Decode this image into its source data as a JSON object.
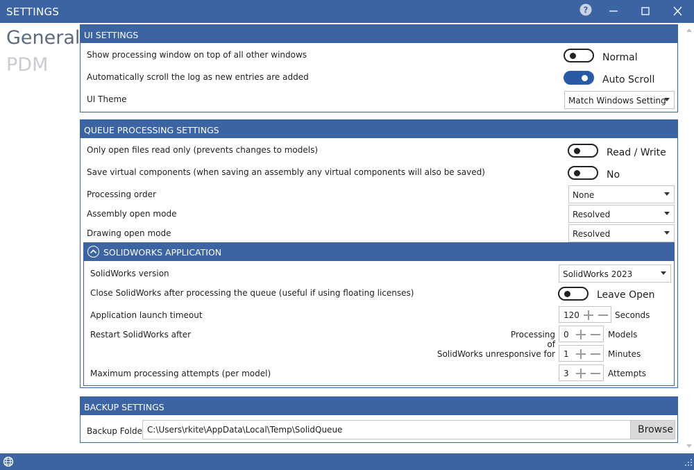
{
  "window": {
    "title": "SETTINGS",
    "help_icon": "question-circle-icon",
    "minimize_icon": "minimize-icon",
    "maximize_icon": "maximize-icon",
    "close_icon": "close-icon",
    "accent": "#3c63a2"
  },
  "nav": {
    "items": [
      {
        "label": "General",
        "active": true
      },
      {
        "label": "PDM",
        "active": false
      }
    ]
  },
  "ui_settings": {
    "header": "UI SETTINGS",
    "ontop": {
      "label": "Show processing window on top of all other windows",
      "state": "Normal",
      "on": false
    },
    "autoscroll": {
      "label": "Automatically scroll the log as new entries are added",
      "state": "Auto Scroll",
      "on": true
    },
    "theme": {
      "label": "UI Theme",
      "value": "Match Windows Setting"
    }
  },
  "queue_settings": {
    "header": "QUEUE PROCESSING SETTINGS",
    "readonly": {
      "label": "Only open files read only (prevents changes to models)",
      "state": "Read / Write",
      "on": false
    },
    "virtual": {
      "label": "Save virtual components (when saving an assembly any virtual components will also be saved)",
      "state": "No",
      "on": false
    },
    "order": {
      "label": "Processing order",
      "value": "None"
    },
    "assembly_mode": {
      "label": "Assembly open mode",
      "value": "Resolved"
    },
    "drawing_mode": {
      "label": "Drawing open mode",
      "value": "Resolved"
    }
  },
  "solidworks": {
    "header": "SOLIDWORKS APPLICATION",
    "version": {
      "label": "SolidWorks version",
      "value": "SolidWorks 2023"
    },
    "close_after": {
      "label": "Close SolidWorks after processing the queue (useful if using floating licenses)",
      "state": "Leave Open",
      "on": false
    },
    "timeout": {
      "label": "Application launch timeout",
      "value": "120",
      "unit": "Seconds"
    },
    "restart": {
      "label": "Restart SolidWorks after",
      "processing_label": "Processing of",
      "processing_value": "0",
      "processing_unit": "Models",
      "unresponsive_label": "SolidWorks unresponsive for",
      "unresponsive_value": "1",
      "unresponsive_unit": "Minutes"
    },
    "max_attempts": {
      "label": "Maximum processing attempts (per model)",
      "value": "3",
      "unit": "Attempts"
    }
  },
  "backup": {
    "header": "BACKUP SETTINGS",
    "folder_label": "Backup Folder",
    "folder_value": "C:\\Users\\rkite\\AppData\\Local\\Temp\\SolidQueue",
    "browse_label": "Browse"
  },
  "statusbar": {
    "globe_icon": "globe-icon",
    "grip_icon": "resize-grip-icon"
  }
}
